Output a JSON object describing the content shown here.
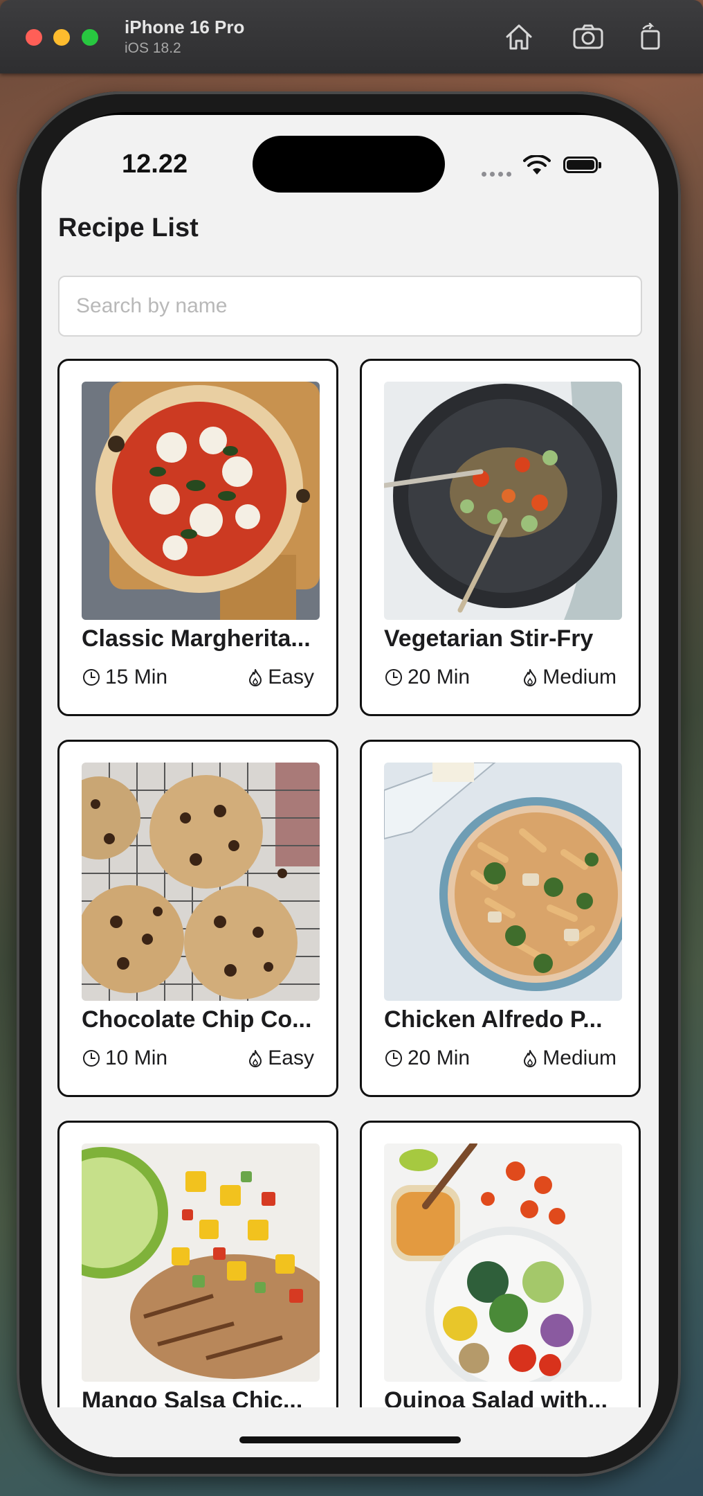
{
  "window": {
    "title": "iPhone 16 Pro",
    "subtitle": "iOS 18.2"
  },
  "toolbar": {
    "home_icon": "home-icon",
    "screenshot_icon": "camera-icon",
    "rotate_icon": "rotate-icon"
  },
  "status_bar": {
    "time": "12.22"
  },
  "page": {
    "title": "Recipe List"
  },
  "search": {
    "placeholder": "Search by name",
    "value": ""
  },
  "recipes": [
    {
      "name": "Classic Margherita...",
      "time": "15 Min",
      "difficulty": "Easy"
    },
    {
      "name": "Vegetarian Stir-Fry",
      "time": "20 Min",
      "difficulty": "Medium"
    },
    {
      "name": "Chocolate Chip Co...",
      "time": "10 Min",
      "difficulty": "Easy"
    },
    {
      "name": "Chicken Alfredo P...",
      "time": "20 Min",
      "difficulty": "Medium"
    },
    {
      "name": "Mango Salsa Chic...",
      "time": "",
      "difficulty": ""
    },
    {
      "name": "Quinoa Salad with...",
      "time": "",
      "difficulty": ""
    }
  ],
  "colors": {
    "accent_red": "#ff5f57",
    "accent_yellow": "#febc2e",
    "accent_green": "#28c840",
    "card_border": "#111111",
    "screen_bg": "#f2f2f2"
  }
}
